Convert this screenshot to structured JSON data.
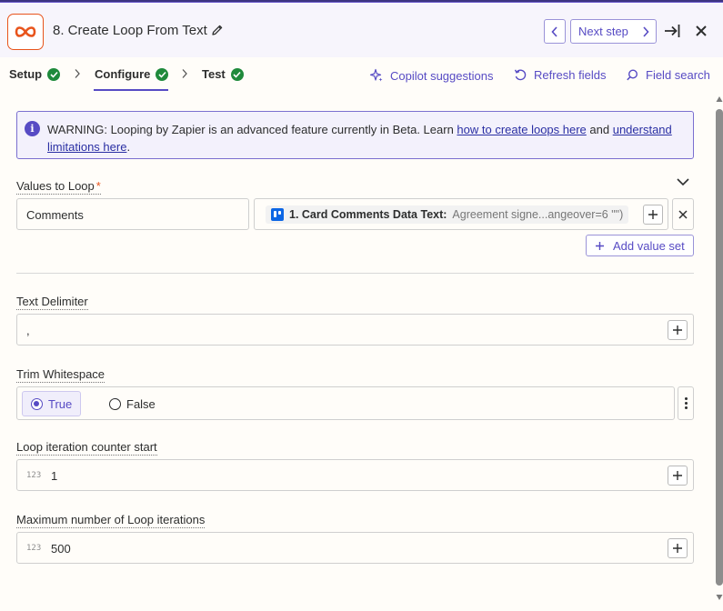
{
  "header": {
    "title": "8. Create Loop From Text",
    "next_step_label": "Next step",
    "icon": "zapier-looping-icon",
    "accent_color": "#e8541c"
  },
  "tabs": [
    {
      "label": "Setup",
      "status": "complete"
    },
    {
      "label": "Configure",
      "status": "complete",
      "active": true
    },
    {
      "label": "Test",
      "status": "complete"
    }
  ],
  "tools": {
    "copilot": "Copilot suggestions",
    "refresh": "Refresh fields",
    "search": "Field search"
  },
  "warning": {
    "prefix": "WARNING: Looping by Zapier is an advanced feature currently in Beta. Learn ",
    "link1": "how to create loops here",
    "middle": " and ",
    "link2": "understand limitations here",
    "suffix": "."
  },
  "values_to_loop": {
    "label": "Values to Loop",
    "required_mark": "*",
    "key": "Comments",
    "pill_label": "1. Card Comments Data Text:",
    "pill_value": "Agreement signe...angeover=6 \"\")",
    "add_value_set": "Add value set"
  },
  "text_delimiter": {
    "label": "Text Delimiter",
    "value": ","
  },
  "trim_whitespace": {
    "label": "Trim Whitespace",
    "options": [
      "True",
      "False"
    ],
    "selected": "True"
  },
  "loop_counter_start": {
    "label": "Loop iteration counter start",
    "type_badge": "123",
    "value": "1"
  },
  "max_iterations": {
    "label": "Maximum number of Loop iterations",
    "type_badge": "123",
    "value": "500"
  },
  "colors": {
    "brand_purple": "#574bc4",
    "success_green": "#1f8a3b",
    "required_orange": "#e8541c"
  }
}
